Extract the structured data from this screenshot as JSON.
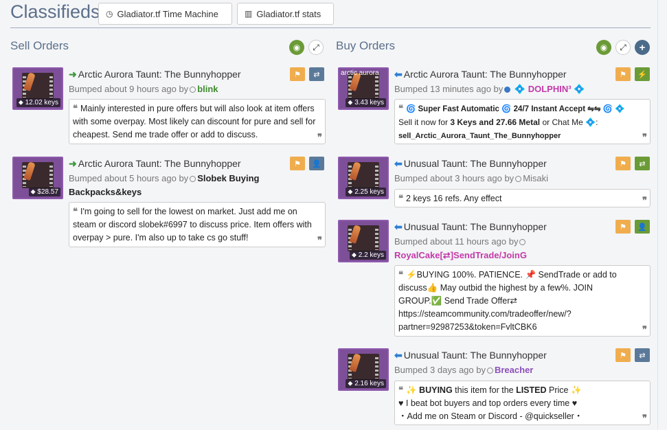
{
  "header": {
    "title": "Classifieds",
    "btn_time_machine": "Gladiator.tf Time Machine",
    "btn_stats": "Gladiator.tf stats"
  },
  "sell": {
    "title": "Sell Orders",
    "listings": [
      {
        "name": "Arctic Aurora Taunt: The Bunnyhopper",
        "price_tag": "12.02 keys",
        "bumped": "Bumped about 9 hours ago by",
        "user": "blink",
        "comment": "Mainly interested in pure offers but will also look at item offers with some overpay. Most likely can discount for pure and sell for cheapest. Send me trade offer or add to discuss."
      },
      {
        "name": "Arctic Aurora Taunt: The Bunnyhopper",
        "price_tag": "$28.57",
        "bumped": "Bumped about 5 hours ago by",
        "user": "Slobek Buying",
        "user_line2": "Backpacks&keys",
        "comment": "I'm going to sell for the lowest on market. Just add me on steam or discord slobek#6997 to discuss price. Item offers with overpay > pure. I'm also up to take cs go stuff!"
      }
    ]
  },
  "buy": {
    "title": "Buy Orders",
    "listings": [
      {
        "name": "Arctic Aurora Taunt: The Bunnyhopper",
        "quality_label": "arctic aurora",
        "price_tag": "3.43 keys",
        "bumped": "Bumped 13 minutes ago by",
        "user": "DOLPHIN³",
        "comment_line1": "🌀 Super Fast Automatic 🌀 24/7 Instant Accept ⇋⇋ 🌀 💠",
        "comment_line2a": "Sell it now for ",
        "comment_line2b": "3 Keys and 27.66 Metal",
        "comment_line2c": " or Chat Me 💠:",
        "comment_line3": "sell_Arctic_Aurora_Taunt_The_Bunnyhopper"
      },
      {
        "name": "Unusual Taunt: The Bunnyhopper",
        "price_tag": "2.25 keys",
        "bumped": "Bumped about 3 hours ago by",
        "user": "Misaki",
        "comment": "2 keys 16 refs. Any effect"
      },
      {
        "name": "Unusual Taunt: The Bunnyhopper",
        "price_tag": "2.2 keys",
        "bumped": "Bumped about 11 hours ago by",
        "user": "RoyalCake[⇄]SendTrade/JoinG",
        "comment_l1": "⚡BUYING 100%. PATIENCE. 📌 SendTrade or add to",
        "comment_l2": "discuss👍 May outbid the highest by a few%. JOIN",
        "comment_l3": "GROUP.✅ Send Trade Offer⇄",
        "comment_l4": "https://steamcommunity.com/tradeoffer/new/?",
        "comment_l5": "partner=92987253&token=FvltCBK6"
      },
      {
        "name": "Unusual Taunt: The Bunnyhopper",
        "price_tag": "2.16 keys",
        "bumped": "Bumped 3 days ago by",
        "user": "Breacher",
        "comment_l1a": "✨ ",
        "comment_l1b": "BUYING",
        "comment_l1c": " this item for the ",
        "comment_l1d": "LISTED",
        "comment_l1e": " Price ✨",
        "comment_l2": "♥ I beat bot buyers and top orders every time ♥",
        "comment_l3": "・Add me on Steam or Discord - @quickseller・"
      }
    ]
  }
}
